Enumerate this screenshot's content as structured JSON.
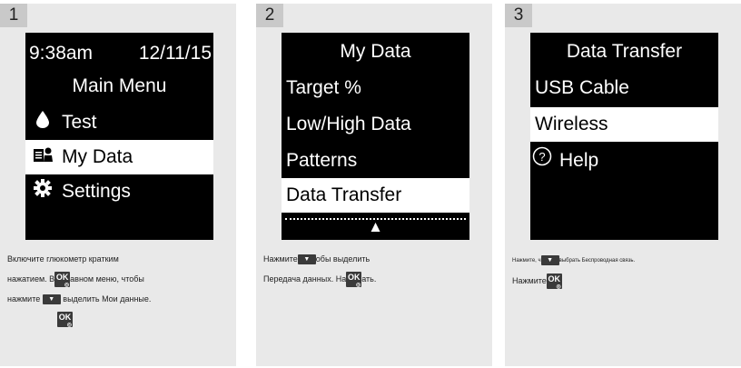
{
  "panel1": {
    "step": "1",
    "status": {
      "time": "9:38am",
      "date": "12/11/15"
    },
    "title": "Main Menu",
    "items": [
      {
        "icon": "drop-icon",
        "label": "Test"
      },
      {
        "icon": "data-icon",
        "label": "My Data"
      },
      {
        "icon": "gear-icon",
        "label": "Settings"
      }
    ],
    "text": {
      "l1": "Включите глюкометр кратким",
      "l2a": "нажатием. В",
      "l2b": "авном меню, чтобы",
      "l3a": "нажмите",
      "l3b": "выделить Мои данные."
    }
  },
  "panel2": {
    "step": "2",
    "title": "My Data",
    "items": [
      "Target %",
      "Low/High Data",
      "Patterns",
      "Data Transfer"
    ],
    "text": {
      "l1a": "Нажмите",
      "l1b": "обы выделить",
      "l2a": "Передача данных. На",
      "l2b": "ать."
    }
  },
  "panel3": {
    "step": "3",
    "title": "Data Transfer",
    "items": [
      "USB Cable",
      "Wireless",
      "Help"
    ],
    "help_icon": "question-circle-icon",
    "text": {
      "l1a": "Нажмите, ч",
      "l1b": "выбрать Беспроводная связь.",
      "l2": "Нажмите"
    }
  },
  "buttons": {
    "ok": "OK",
    "down": "▼"
  },
  "colors": {
    "panel": "#e9e9e9",
    "step_tab": "#c9c9c9",
    "screen": "#000000",
    "selected": "#ffffff",
    "button": "#3a3a3a"
  }
}
